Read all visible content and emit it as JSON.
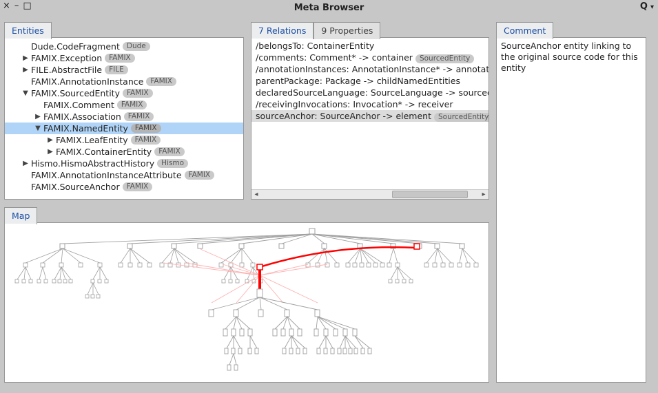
{
  "window": {
    "title": "Meta Browser",
    "controls": {
      "close": "×",
      "minimize": "–",
      "maximize": "□"
    },
    "search_icon": "Q",
    "dropdown_icon": "▾"
  },
  "entities": {
    "tab_label": "Entities",
    "rows": [
      {
        "indent": 1,
        "toggle": "",
        "name": "Dude.CodeFragment",
        "badge": "Dude",
        "selected": false
      },
      {
        "indent": 1,
        "toggle": "▶",
        "name": "FAMIX.Exception",
        "badge": "FAMIX",
        "selected": false
      },
      {
        "indent": 1,
        "toggle": "▶",
        "name": "FILE.AbstractFile",
        "badge": "FILE",
        "selected": false
      },
      {
        "indent": 1,
        "toggle": "",
        "name": "FAMIX.AnnotationInstance",
        "badge": "FAMIX",
        "selected": false
      },
      {
        "indent": 1,
        "toggle": "▼",
        "name": "FAMIX.SourcedEntity",
        "badge": "FAMIX",
        "selected": false
      },
      {
        "indent": 2,
        "toggle": "",
        "name": "FAMIX.Comment",
        "badge": "FAMIX",
        "selected": false
      },
      {
        "indent": 2,
        "toggle": "▶",
        "name": "FAMIX.Association",
        "badge": "FAMIX",
        "selected": false
      },
      {
        "indent": 2,
        "toggle": "▼",
        "name": "FAMIX.NamedEntity",
        "badge": "FAMIX",
        "selected": true
      },
      {
        "indent": 3,
        "toggle": "▶",
        "name": "FAMIX.LeafEntity",
        "badge": "FAMIX",
        "selected": false
      },
      {
        "indent": 3,
        "toggle": "▶",
        "name": "FAMIX.ContainerEntity",
        "badge": "FAMIX",
        "selected": false
      },
      {
        "indent": 1,
        "toggle": "▶",
        "name": "Hismo.HismoAbstractHistory",
        "badge": "Hismo",
        "selected": false
      },
      {
        "indent": 1,
        "toggle": "",
        "name": "FAMIX.AnnotationInstanceAttribute",
        "badge": "FAMIX",
        "selected": false
      },
      {
        "indent": 1,
        "toggle": "",
        "name": "FAMIX.SourceAnchor",
        "badge": "FAMIX",
        "selected": false
      }
    ]
  },
  "relations": {
    "tab_label": "7 Relations",
    "other_tab_label": "9 Properties",
    "rows": [
      {
        "text": "/belongsTo: ContainerEntity",
        "badge": "",
        "selected": false
      },
      {
        "text": "/comments: Comment* -> container",
        "badge": "SourcedEntity",
        "selected": false
      },
      {
        "text": "/annotationInstances: AnnotationInstance* -> annotated",
        "badge": "",
        "selected": false
      },
      {
        "text": "parentPackage: Package -> childNamedEntities",
        "badge": "",
        "selected": false
      },
      {
        "text": "declaredSourceLanguage: SourceLanguage -> sourcedE",
        "badge": "",
        "selected": false
      },
      {
        "text": "/receivingInvocations: Invocation* -> receiver",
        "badge": "",
        "selected": false
      },
      {
        "text": "sourceAnchor: SourceAnchor -> element",
        "badge": "SourcedEntity",
        "selected": true
      }
    ]
  },
  "comment": {
    "tab_label": "Comment",
    "text": "SourceAnchor entity linking to the original source code for this entity"
  },
  "map": {
    "tab_label": "Map"
  },
  "colors": {
    "selected_row_bg": "#b0d4f7",
    "grey_selected_row_bg": "#dcdcdc",
    "accent_red": "#ff0000",
    "tab_active_fg": "#1a4ea6",
    "window_bg": "#c7c7c7"
  }
}
